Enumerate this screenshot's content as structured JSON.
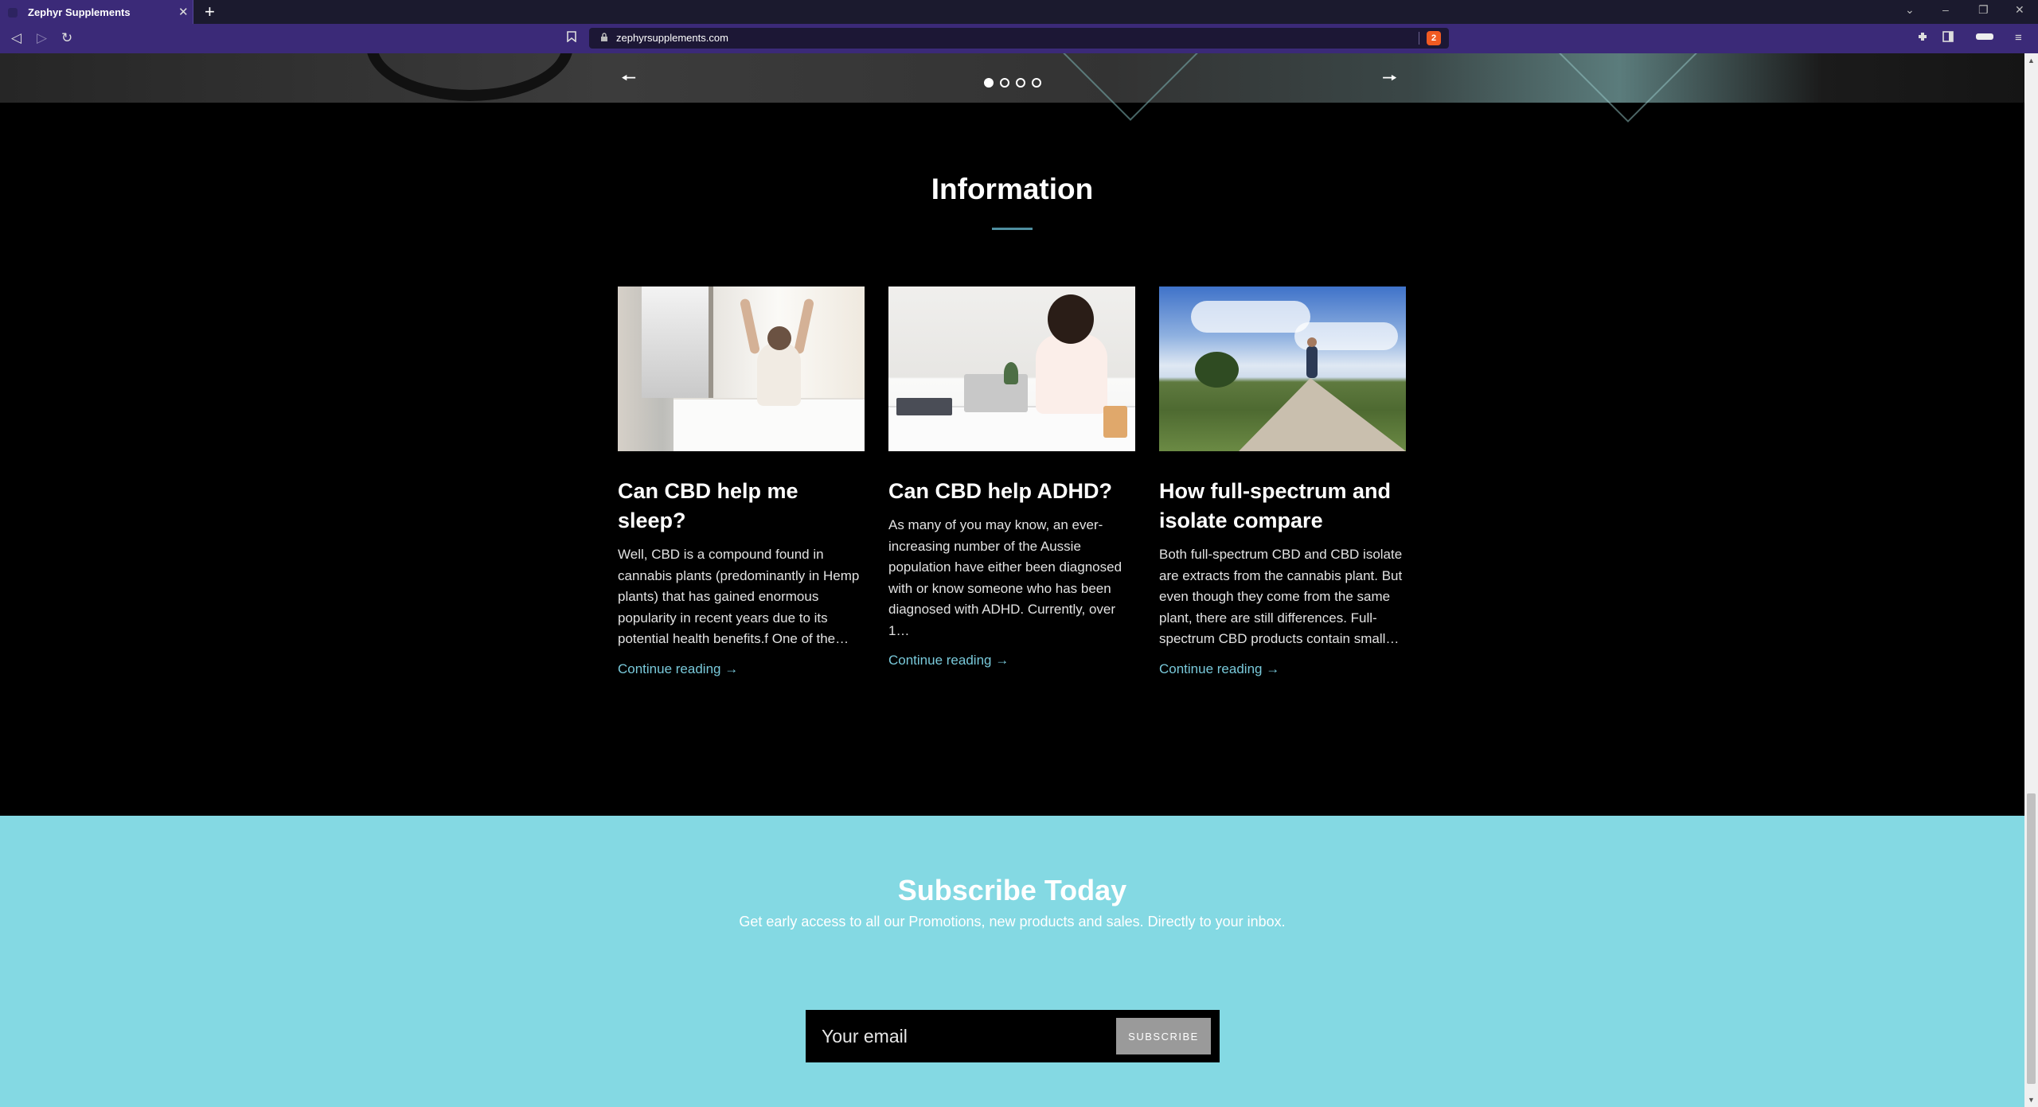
{
  "browser": {
    "tab_title": "Zephyr Supplements",
    "tab_close": "✕",
    "new_tab": "+",
    "url": "zephyrsupplements.com",
    "shield_count": "2",
    "window_controls": {
      "chevron": "⌄",
      "minimize": "–",
      "restore": "❐",
      "close": "✕"
    },
    "nav": {
      "back": "◁",
      "forward": "▷",
      "reload": "↻"
    },
    "toolbar_icons": {
      "bookmark": "🔖",
      "extensions": "✱",
      "sidebar": "▯",
      "wallet": "▬",
      "menu": "≡"
    }
  },
  "hero": {
    "prev_arrow": "🠔",
    "next_arrow": "🠖",
    "slide_count": 4,
    "active_slide": 1
  },
  "information": {
    "title": "Information",
    "accent_color": "#4f8fa0",
    "posts": [
      {
        "image_icon": "bedroom-stretch-photo",
        "title": "Can CBD help me sleep?",
        "excerpt": "Well, CBD is a compound found in cannabis plants (predominantly in Hemp plants) that has gained enormous popularity in recent years due to its potential health benefits.f One of the…",
        "link": "Continue reading →"
      },
      {
        "image_icon": "tired-student-photo",
        "title": "Can CBD help ADHD?",
        "excerpt": "As many of you may know, an ever-increasing number of the Aussie population have either been diagnosed with or know someone who has been diagnosed with ADHD. Currently, over 1…",
        "link": "Continue reading →"
      },
      {
        "image_icon": "runner-landscape-photo",
        "title": "How full-spectrum and isolate compare",
        "excerpt": "Both full-spectrum CBD and CBD isolate are extracts from the cannabis plant. But even though they come from the same plant, there are still differences. Full-spectrum CBD products contain small…",
        "link": "Continue reading →"
      }
    ],
    "link_color": "#79c9da"
  },
  "subscribe": {
    "title": "Subscribe Today",
    "description": "Get early access to all our Promotions, new products and sales. Directly to your inbox.",
    "email_placeholder": "Your email",
    "button_label": "SUBSCRIBE",
    "background_color": "#84d9e3"
  }
}
